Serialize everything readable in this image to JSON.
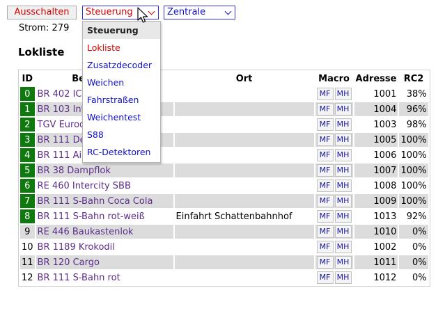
{
  "toolbar": {
    "power_button": "Ausschalten",
    "menu_select": "Steuerung",
    "zentrale_select": "Zentrale"
  },
  "status": {
    "strom": "Strom: 279"
  },
  "page": {
    "title": "Lokliste"
  },
  "menu": {
    "items": [
      {
        "label": "Steuerung",
        "state": "header"
      },
      {
        "label": "Lokliste",
        "state": "active"
      },
      {
        "label": "Zusatzdecoder",
        "state": "normal"
      },
      {
        "label": "Weichen",
        "state": "normal"
      },
      {
        "label": "Fahrstraßen",
        "state": "normal"
      },
      {
        "label": "Weichentest",
        "state": "normal"
      },
      {
        "label": "S88",
        "state": "normal"
      },
      {
        "label": "RC-Detektoren",
        "state": "normal"
      }
    ]
  },
  "table": {
    "headers": [
      "ID",
      "Bezeichnung",
      "Ort",
      "Macro",
      "Adresse",
      "RC2"
    ],
    "macro_buttons": [
      "MF",
      "MH"
    ],
    "rows": [
      {
        "id": "0",
        "name": "BR 402 ICE",
        "ort": "",
        "adresse": "1001",
        "rc2": "38%",
        "active": true
      },
      {
        "id": "1",
        "name": "BR 103 Intercity",
        "ort": "",
        "adresse": "1004",
        "rc2": "96%",
        "active": true
      },
      {
        "id": "2",
        "name": "TGV Euroduplex",
        "ort": "",
        "adresse": "1003",
        "rc2": "98%",
        "active": true
      },
      {
        "id": "3",
        "name": "BR 111 Desiro",
        "ort": "",
        "adresse": "1005",
        "rc2": "100%",
        "active": true
      },
      {
        "id": "4",
        "name": "BR 111 Airport Express",
        "ort": "",
        "adresse": "1006",
        "rc2": "100%",
        "active": true
      },
      {
        "id": "5",
        "name": "BR 38 Dampflok",
        "ort": "",
        "adresse": "1007",
        "rc2": "100%",
        "active": true
      },
      {
        "id": "6",
        "name": "RE 460 Intercity SBB",
        "ort": "",
        "adresse": "1008",
        "rc2": "100%",
        "active": true
      },
      {
        "id": "7",
        "name": "BR 111 S-Bahn Coca Cola",
        "ort": "",
        "adresse": "1009",
        "rc2": "100%",
        "active": true
      },
      {
        "id": "8",
        "name": "BR 111 S-Bahn rot-weiß",
        "ort": "Einfahrt Schattenbahnhof",
        "adresse": "1013",
        "rc2": "92%",
        "active": true
      },
      {
        "id": "9",
        "name": "RE 446 Baukastenlok",
        "ort": "",
        "adresse": "1010",
        "rc2": "0%",
        "active": false
      },
      {
        "id": "10",
        "name": "BR 1189 Krokodil",
        "ort": "",
        "adresse": "1002",
        "rc2": "0%",
        "active": false
      },
      {
        "id": "11",
        "name": "BR 120 Cargo",
        "ort": "",
        "adresse": "1011",
        "rc2": "0%",
        "active": false
      },
      {
        "id": "12",
        "name": "BR 111 S-Bahn rot",
        "ort": "",
        "adresse": "1012",
        "rc2": "0%",
        "active": false
      }
    ]
  },
  "colors": {
    "accent_red": "#d40000",
    "link_blue": "#1010c8",
    "active_id_green": "#0e7a0e",
    "row_alt_gray": "#dcdcdc"
  }
}
